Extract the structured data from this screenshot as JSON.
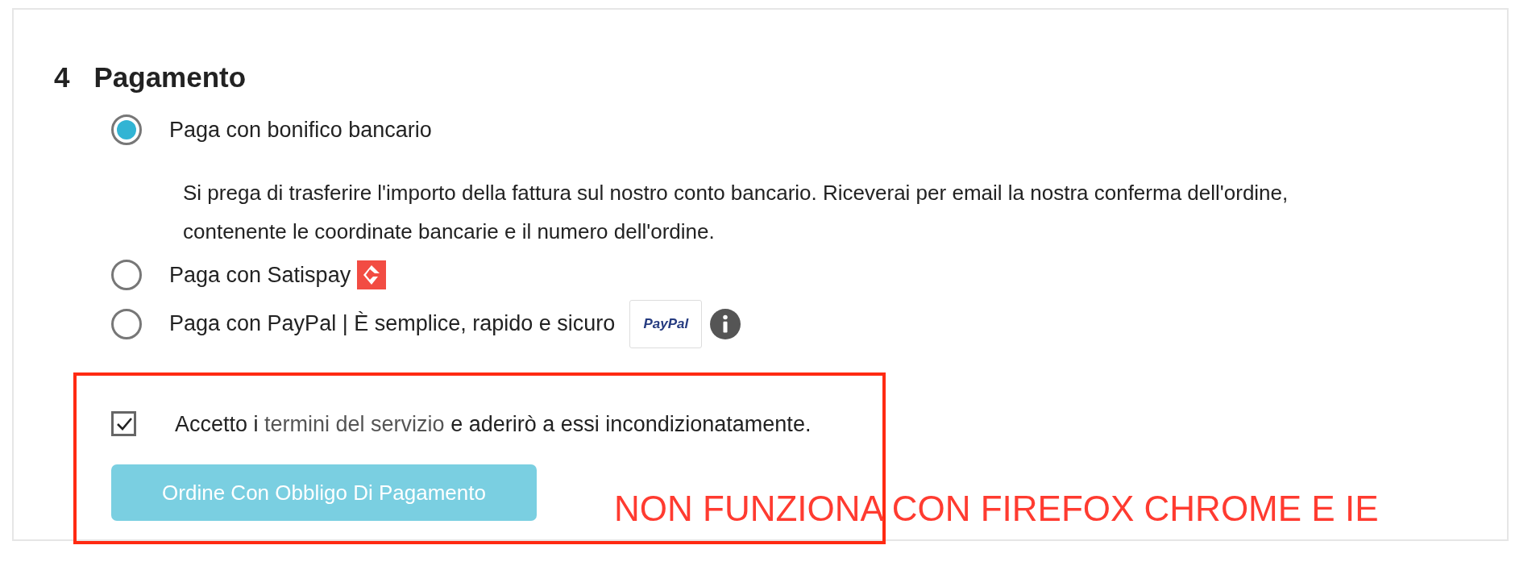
{
  "section": {
    "number": "4",
    "title": "Pagamento"
  },
  "payment_options": [
    {
      "kind": "plain",
      "label": "Paga con bonifico bancario",
      "selected": true,
      "description": "Si prega di trasferire l'importo della fattura sul nostro conto bancario. Riceverai per email la nostra conferma dell'ordine, contenente le coordinate bancarie e il numero dell'ordine."
    },
    {
      "kind": "satispay",
      "label": "Paga con Satispay",
      "selected": false
    },
    {
      "kind": "paypal",
      "label": "Paga con PayPal | È semplice, rapido e sicuro",
      "selected": false,
      "badge": "PayPal"
    }
  ],
  "terms": {
    "checked": true,
    "before": "Accetto i",
    "link": "termini del servizio",
    "after": "e aderirò a essi incondizionatamente."
  },
  "order_button": "Ordine Con Obbligo Di Pagamento",
  "annotation": {
    "text": "NON FUNZIONA CON FIREFOX CHROME E IE"
  }
}
